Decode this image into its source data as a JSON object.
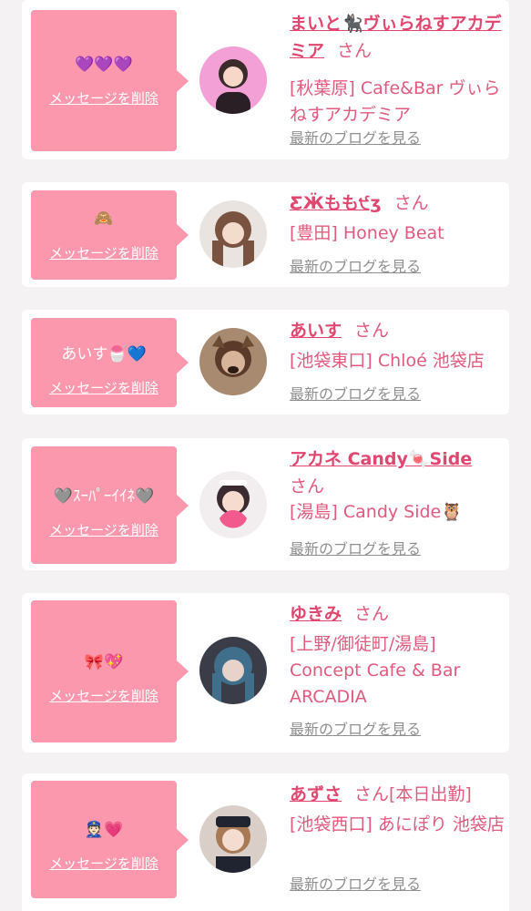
{
  "entries": [
    {
      "message": "💜💜💜",
      "delete_label": "メッセージを削除",
      "name": "まいと🐈‍⬛ヴぃらねすアカデミア",
      "honorific": "さん",
      "location": "[秋葉原] Cafe&Bar ヴぃらねすアカデミア",
      "blog_label": "最新のブログを見る"
    },
    {
      "message": "🙈",
      "delete_label": "メッセージを削除",
      "name": "ƸӜもも੯ʒ",
      "honorific": "さん",
      "location": "[豊田] Honey Beat",
      "blog_label": "最新のブログを見る"
    },
    {
      "message": "あいす🍧💙",
      "delete_label": "メッセージを削除",
      "name": "あいす",
      "honorific": "さん",
      "location": "[池袋東口] Chloé 池袋店",
      "blog_label": "最新のブログを見る"
    },
    {
      "message": "🩶ｽｰﾊﾟｰｲｲﾈ🩶",
      "delete_label": "メッセージを削除",
      "name": "アカネ Candy🍬Side",
      "honorific": "さん",
      "location": "[湯島] Candy Side🦉",
      "blog_label": "最新のブログを見る"
    },
    {
      "message": "🎀💖",
      "delete_label": "メッセージを削除",
      "name": "ゆきみ",
      "honorific": "さん",
      "location": "[上野/御徒町/湯島] Concept Cafe & Bar ARCADIA",
      "blog_label": "最新のブログを見る"
    },
    {
      "message": "👮🏻💗",
      "delete_label": "メッセージを削除",
      "name": "あずさ",
      "honorific": "さん[本日出勤]",
      "location": "[池袋西口] あにぽり 池袋店",
      "blog_label": "最新のブログを見る"
    }
  ],
  "colors": {
    "bubble": "#fc98ad",
    "name": "#e0466e",
    "text": "#e05a7d",
    "blog_link": "#8f8f8f",
    "background": "#f4f2f3"
  }
}
